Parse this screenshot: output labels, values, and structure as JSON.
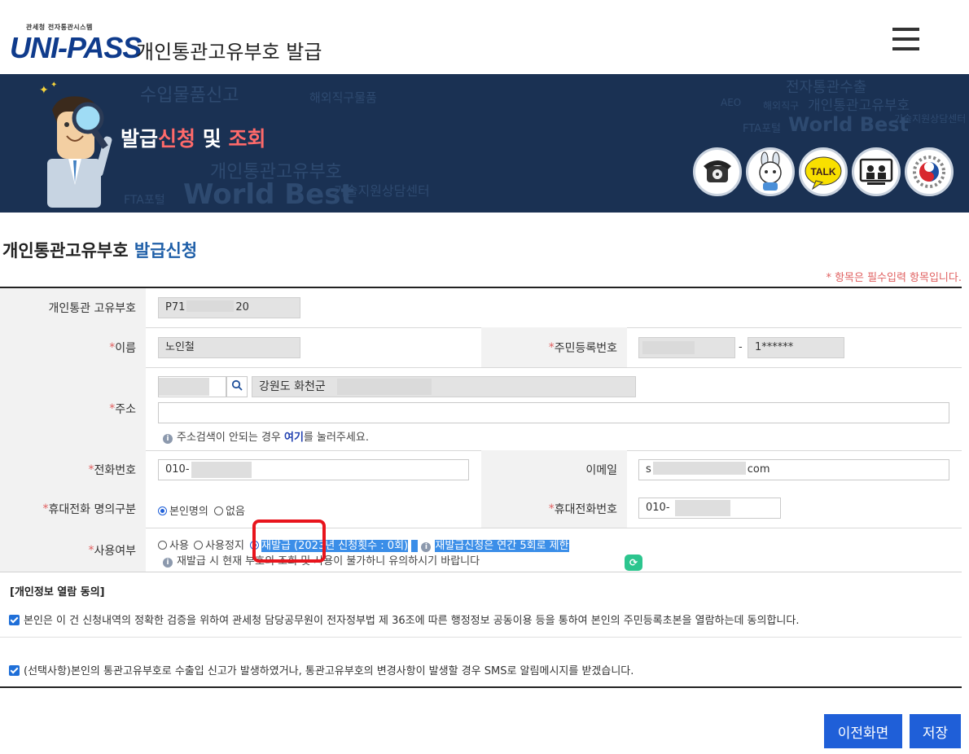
{
  "header": {
    "logo_subtitle": "관세청 전자통관시스템",
    "logo_text": "UNI-PASS",
    "app_title": "개인통관고유부호 발급"
  },
  "banner": {
    "title_part1": "발급",
    "title_part2": "신청",
    "title_part3": " 및 ",
    "title_part4": "조회",
    "background_words": [
      "수입물품신고",
      "해외직구물품",
      "전자통관수출",
      "개인통관고유부호",
      "World Best",
      "FTA포털",
      "기술지원상담센터",
      "해외직구",
      "AEO",
      "개인통관고유부호",
      "World Best",
      "기술지원상담센터",
      "FTA포털"
    ],
    "icons": [
      "telephone-icon",
      "chatbot-icon",
      "kakao-talk-icon",
      "remote-support-icon",
      "government-emblem-icon"
    ],
    "talk_label": "TALK"
  },
  "page": {
    "section_title_black": "개인통관고유부호",
    "section_title_blue": "발급신청",
    "required_note": "* 항목은 필수입력 항목입니다."
  },
  "form": {
    "code": {
      "label": "개인통관 고유부호",
      "value_prefix": "P71",
      "value_suffix": "20"
    },
    "name": {
      "label": "이름",
      "value": "노인철"
    },
    "rrn": {
      "label": "주민등록번호",
      "separator": "-",
      "back": "1******"
    },
    "address": {
      "label": "주소",
      "addr1": "강원도 화천군 ",
      "addr2": "",
      "help_prefix": "주소검색이 안되는 경우 ",
      "help_link": "여기",
      "help_suffix": "를 눌러주세요."
    },
    "phone": {
      "label": "전화번호",
      "value": "010-"
    },
    "email": {
      "label": "이메일",
      "value_prefix": "s",
      "value_suffix": "com"
    },
    "mobile_owner": {
      "label": "휴대전화 명의구분",
      "opt1": "본인명의",
      "opt2": "없음"
    },
    "mobile": {
      "label": "휴대전화번호",
      "value": "010-"
    },
    "usage": {
      "label": "사용여부",
      "opt1": "사용",
      "opt2": "사용정지",
      "opt3": "재발급 (2023년 신청횟수 : 0회)",
      "note": "재발급신청은 연간 5회로 제한",
      "help": "재발급 시 현재 부호의 조회 및 사용이 불가하니 유의하시기 바랍니다"
    }
  },
  "consent": {
    "title": "[개인정보 열람 동의]",
    "item1": "본인은 이 건 신청내역의 정확한 검증을 위하여 관세청 담당공무원이 전자정부법 제 36조에 따른 행정정보 공동이용 등을 통하여 본인의 주민등록초본을 열람하는데 동의합니다.",
    "item2": "(선택사항)본인의 통관고유부호로 수출입 신고가 발생하였거나, 통관고유부호의 변경사항이 발생할 경우 SMS로 알림메시지를 받겠습니다."
  },
  "buttons": {
    "prev": "이전화면",
    "save": "저장"
  }
}
